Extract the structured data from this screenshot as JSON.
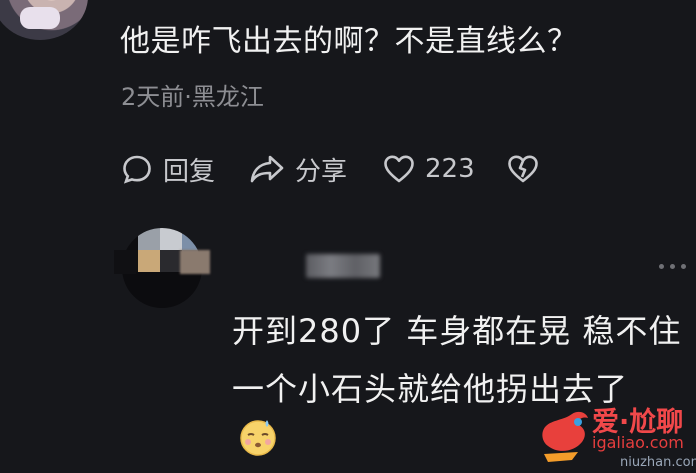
{
  "comment": {
    "text": "他是咋飞出去的啊？不是直线么？",
    "meta": "2天前·黑龙江"
  },
  "actions": {
    "reply_label": "回复",
    "share_label": "分享",
    "like_count": "223"
  },
  "reply": {
    "line1": "开到280了 车身都在晃 稳不住",
    "line2": "一个小石头就给他拐出去了"
  },
  "watermark": {
    "title": "爱·尬聊",
    "url": "igaliao.com",
    "subdomain": "niuzhan.com"
  },
  "icons": {
    "reply": "comment-bubble-icon",
    "share": "share-arrow-icon",
    "like": "heart-icon",
    "dislike": "broken-heart-icon",
    "more": "more-dots-icon"
  },
  "colors": {
    "background": "#16171b",
    "text": "#f1f1f1",
    "secondary": "#8d8e93",
    "watermark_red": "#f1484a"
  }
}
